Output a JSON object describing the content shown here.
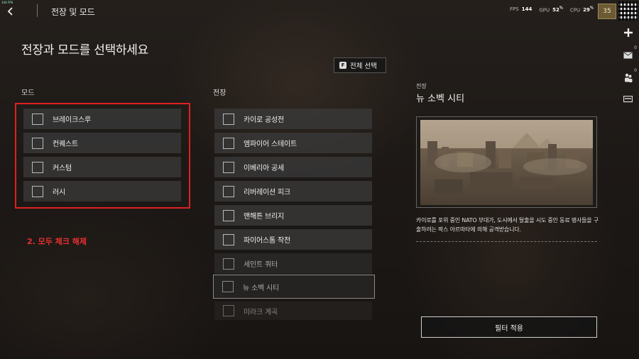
{
  "overlay": {
    "fps_small": "144 FPS"
  },
  "header": {
    "title": "전장 및 모드",
    "stats": [
      {
        "name": "FPS",
        "value": "144",
        "unit": ""
      },
      {
        "name": "GPU",
        "value": "52",
        "unit": "%"
      },
      {
        "name": "CPU",
        "value": "29",
        "unit": "%"
      }
    ],
    "level": "35"
  },
  "rail": {
    "counts": [
      "0",
      "0"
    ]
  },
  "page": {
    "heading": "전장과 모드를 선택하세요",
    "select_all": {
      "key": "F",
      "label": "전체 선택"
    }
  },
  "modes": {
    "label": "모드",
    "items": [
      {
        "label": "브레이크스루",
        "checked": false
      },
      {
        "label": "컨퀘스트",
        "checked": false
      },
      {
        "label": "커스텀",
        "checked": false
      },
      {
        "label": "러시",
        "checked": false
      }
    ]
  },
  "maps": {
    "label": "전장",
    "items": [
      {
        "label": "카이로 공성전",
        "state": "normal"
      },
      {
        "label": "엠파이어 스테이트",
        "state": "normal"
      },
      {
        "label": "이베리아 공세",
        "state": "normal"
      },
      {
        "label": "리버레이션 피크",
        "state": "normal"
      },
      {
        "label": "맨해튼 브리지",
        "state": "faded"
      },
      {
        "label": "파이어스톰 작전",
        "state": "faded"
      },
      {
        "label": "세인트 쿼터",
        "state": "faded"
      },
      {
        "label": "뉴 소벡 시티",
        "state": "hover"
      },
      {
        "label": "미라크 계곡",
        "state": "ghost"
      }
    ]
  },
  "annotation": {
    "text": "2. 모두 체크 해제"
  },
  "detail": {
    "kicker": "전장",
    "title": "뉴 소벡 시티",
    "description": "카이로를 포위 중인 NATO 부대가, 도시에서 탈출을 시도 중인 동료 병사들을 구출하려는 팍스 아르마타에 의해 공격받습니다."
  },
  "footer": {
    "apply_label": "필터 적용"
  },
  "colors": {
    "annotation": "#e02020",
    "accent": "#a08a55"
  }
}
